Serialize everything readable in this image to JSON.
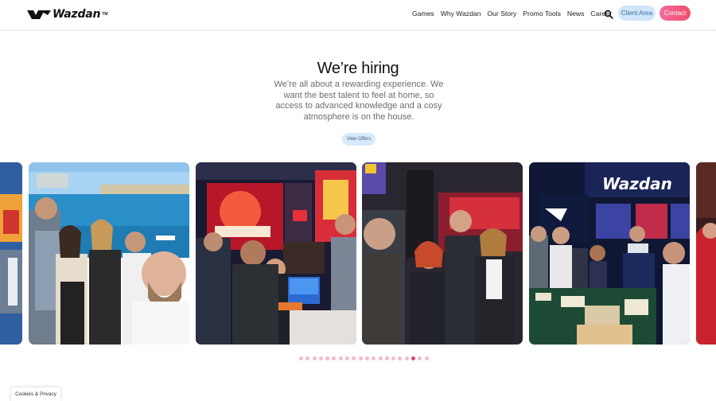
{
  "brand": {
    "name": "Wazdan",
    "tm": "TM"
  },
  "nav": {
    "items": [
      "Games",
      "Why Wazdan",
      "Our Story",
      "Promo Tools",
      "News",
      "Career"
    ],
    "client_area": "Client Area",
    "contact": "Contact"
  },
  "hero": {
    "title": "We’re hiring",
    "text": "We’re all about a rewarding experience. We want the best talent to feel at home, so access to advanced knowledge and a cosy atmosphere is on the house.",
    "button": "View Offers"
  },
  "carousel": {
    "slides": [
      {
        "name": "slide-partial-left",
        "scene": "casino-expo-partial"
      },
      {
        "name": "slide-team-harbour",
        "scene": "team-selfie-harbour"
      },
      {
        "name": "slide-slot-machine-booth",
        "scene": "slot-machine-demo"
      },
      {
        "name": "slide-wazdan-booth-selfie",
        "scene": "expo-booth-selfie"
      },
      {
        "name": "slide-wazdan-stand-catering",
        "scene": "wazdan-stand-catering"
      },
      {
        "name": "slide-partial-right",
        "scene": "person-partial"
      }
    ],
    "dot_count": 20,
    "active_dot": 17
  },
  "cookies": {
    "label": "Cookies & Privacy"
  },
  "colors": {
    "accent_pink": "#ef4f6c",
    "client_bg": "#cfe6fb",
    "dot_inactive": "#f3b9cb",
    "dot_active": "#e8426e"
  },
  "icons": {
    "search": "search-icon",
    "logo": "wazdan-logo-icon"
  }
}
